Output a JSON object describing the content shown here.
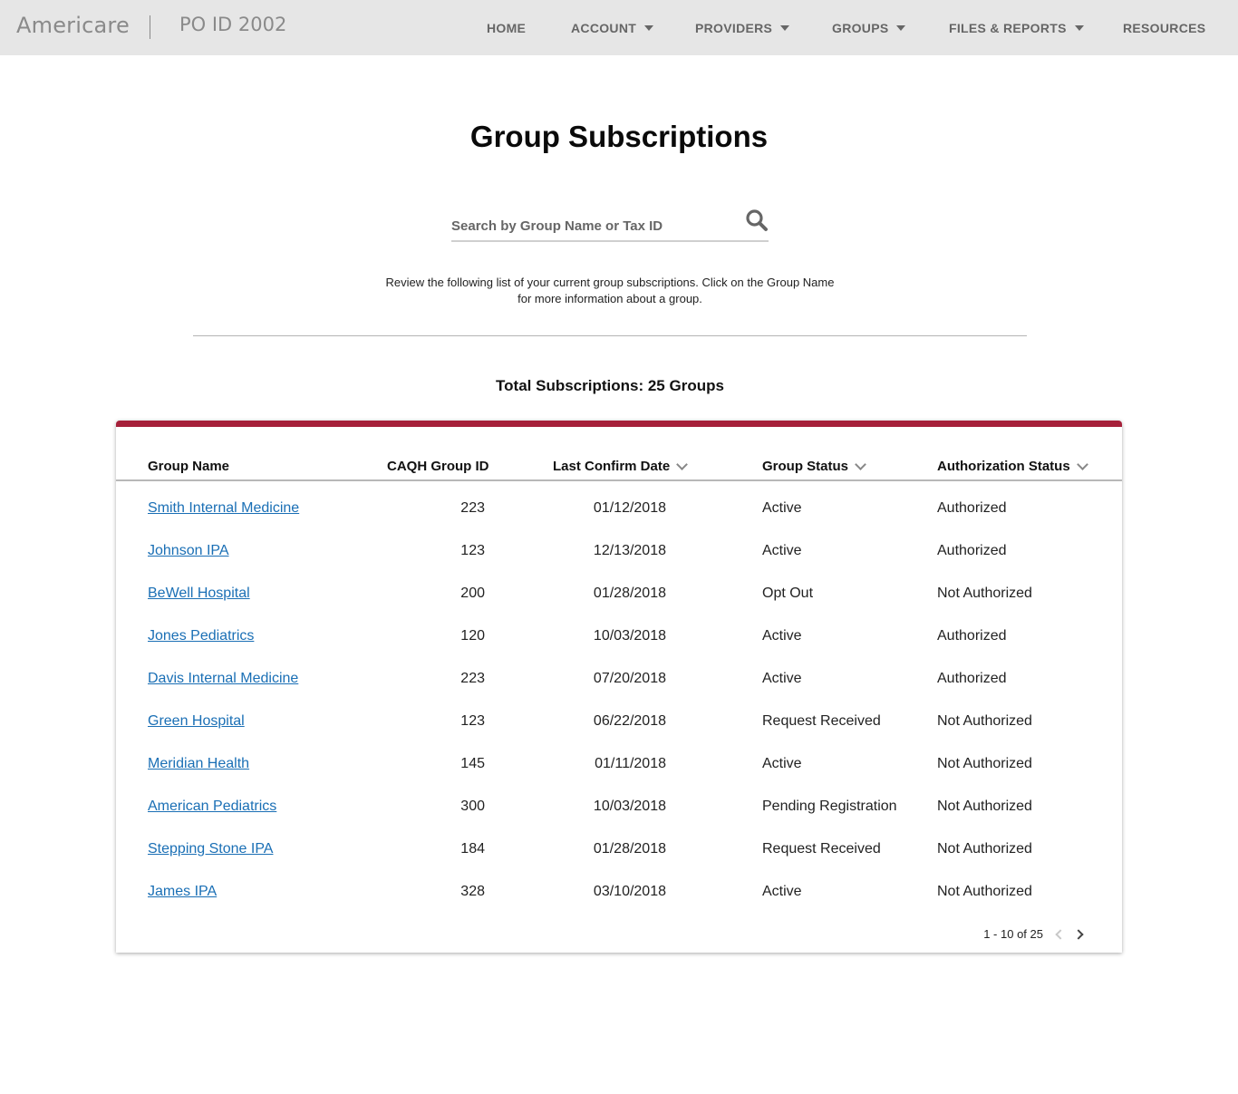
{
  "header": {
    "brand": "Americare",
    "po_id": "PO ID 2002",
    "nav": [
      {
        "label": "HOME",
        "dropdown": false
      },
      {
        "label": "ACCOUNT",
        "dropdown": true
      },
      {
        "label": "PROVIDERS",
        "dropdown": true
      },
      {
        "label": "GROUPS",
        "dropdown": true
      },
      {
        "label": "FILES & REPORTS",
        "dropdown": true
      },
      {
        "label": "RESOURCES",
        "dropdown": false
      }
    ]
  },
  "page": {
    "title": "Group Subscriptions",
    "search_placeholder": "Search by Group Name or Tax ID",
    "intro_line1": "Review the following list of your current group subscriptions. Click on the Group Name",
    "intro_line2": "for more information about a group.",
    "total": "Total Subscriptions: 25 Groups"
  },
  "table": {
    "columns": {
      "group_name": "Group Name",
      "caqh_id": "CAQH Group ID",
      "last_confirm": "Last Confirm Date",
      "group_status": "Group Status",
      "auth_status": "Authorization Status"
    },
    "rows": [
      {
        "name": "Smith Internal Medicine",
        "id": "223",
        "date": "01/12/2018",
        "status": "Active",
        "auth": "Authorized"
      },
      {
        "name": "Johnson IPA",
        "id": "123",
        "date": "12/13/2018",
        "status": "Active",
        "auth": "Authorized"
      },
      {
        "name": "BeWell Hospital",
        "id": "200",
        "date": "01/28/2018",
        "status": "Opt Out",
        "auth": "Not Authorized"
      },
      {
        "name": "Jones Pediatrics",
        "id": "120",
        "date": "10/03/2018",
        "status": "Active",
        "auth": "Authorized"
      },
      {
        "name": "Davis Internal Medicine",
        "id": "223",
        "date": "07/20/2018",
        "status": "Active",
        "auth": "Authorized"
      },
      {
        "name": "Green Hospital",
        "id": "123",
        "date": "06/22/2018",
        "status": "Request Received",
        "auth": "Not Authorized"
      },
      {
        "name": "Meridian Health",
        "id": "145",
        "date": "01/11/2018",
        "status": "Active",
        "auth": "Not Authorized"
      },
      {
        "name": "American Pediatrics",
        "id": "300",
        "date": "10/03/2018",
        "status": "Pending Registration",
        "auth": "Not Authorized"
      },
      {
        "name": "Stepping Stone IPA",
        "id": "184",
        "date": "01/28/2018",
        "status": "Request Received",
        "auth": "Not Authorized"
      },
      {
        "name": "James IPA",
        "id": "328",
        "date": "03/10/2018",
        "status": "Active",
        "auth": "Not Authorized"
      }
    ],
    "pagination": "1 - 10 of 25"
  },
  "colors": {
    "accent": "#a6203a",
    "link": "#1a6fb5",
    "header_bg": "#e6e6e6"
  },
  "icons": {
    "search": "search-icon",
    "sort": "chevron-down-icon",
    "nav_dropdown": "caret-down-icon",
    "prev": "chevron-left-icon",
    "next": "chevron-right-icon"
  }
}
